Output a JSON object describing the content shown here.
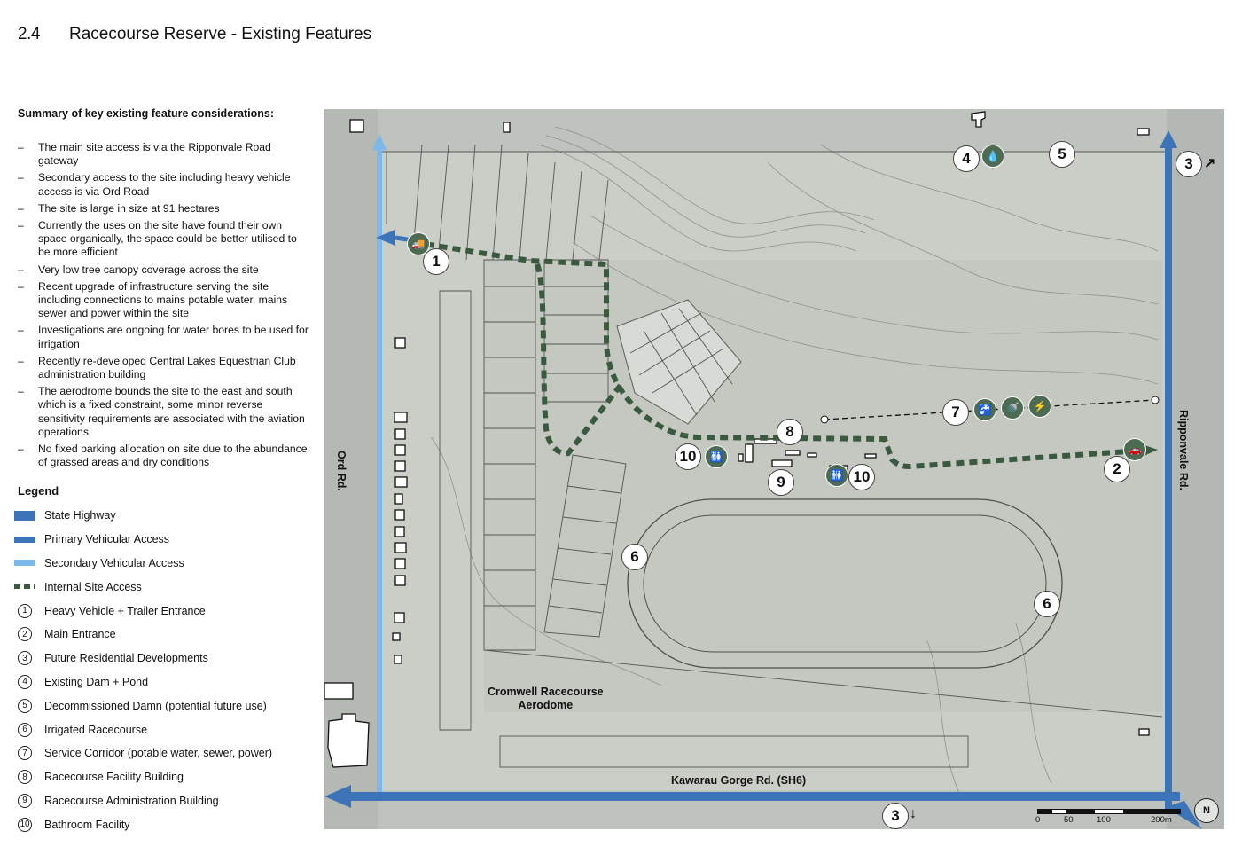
{
  "header": {
    "number": "2.4",
    "title": "Racecourse Reserve - Existing Features"
  },
  "summary": {
    "heading": "Summary of key existing feature considerations:",
    "items": [
      "The main site access is via the Ripponvale Road gateway",
      "Secondary access to the site including heavy vehicle access is via Ord Road",
      "The site is large in size at 91 hectares",
      "Currently the uses on the site have found their own space organically, the space could be better utilised to be more efficient",
      "Very low tree canopy coverage across the site",
      "Recent upgrade of infrastructure serving the site including connections to mains potable water, mains sewer and power within the site",
      "Investigations are ongoing for water bores to be used for irrigation",
      "Recently re-developed Central Lakes Equestrian Club administration building",
      "The aerodrome bounds the site to the east and south which is a fixed constraint, some minor reverse sensitivity requirements are associated with the aviation operations",
      "No fixed parking allocation on site due to the abundance of grassed areas and dry conditions"
    ]
  },
  "legend": {
    "heading": "Legend",
    "items": [
      {
        "symbol": "swatch",
        "color": "#3d74b8",
        "label": "State Highway"
      },
      {
        "symbol": "swatch",
        "color": "#3d74b8",
        "label": "Primary Vehicular Access"
      },
      {
        "symbol": "swatch",
        "color": "#7db8ec",
        "label": "Secondary Vehicular Access"
      },
      {
        "symbol": "dash",
        "color": "#3a5a40",
        "label": "Internal Site Access"
      },
      {
        "symbol": "number",
        "value": "1",
        "label": "Heavy Vehicle + Trailer Entrance"
      },
      {
        "symbol": "number",
        "value": "2",
        "label": "Main Entrance"
      },
      {
        "symbol": "number",
        "value": "3",
        "label": "Future Residential Developments"
      },
      {
        "symbol": "number",
        "value": "4",
        "label": "Existing Dam + Pond"
      },
      {
        "symbol": "number",
        "value": "5",
        "label": "Decommissioned Damn (potential future use)"
      },
      {
        "symbol": "number",
        "value": "6",
        "label": "Irrigated Racecourse"
      },
      {
        "symbol": "number",
        "value": "7",
        "label": "Service Corridor (potable water, sewer, power)"
      },
      {
        "symbol": "number",
        "value": "8",
        "label": "Racecourse Facility Building"
      },
      {
        "symbol": "number",
        "value": "9",
        "label": "Racecourse Administration Building"
      },
      {
        "symbol": "number",
        "value": "10",
        "label": "Bathroom Facility"
      }
    ]
  },
  "map": {
    "road_labels": {
      "ord": "Ord Rd.",
      "ripponvale": "Ripponvale Rd.",
      "sh6": "Kawarau Gorge Rd. (SH6)",
      "aerodrome_line1": "Cromwell Racecourse",
      "aerodrome_line2": "Aerodome"
    },
    "markers": [
      "1",
      "2",
      "3",
      "3",
      "4",
      "5",
      "6",
      "6",
      "7",
      "8",
      "9",
      "10",
      "10"
    ],
    "scale": {
      "t0": "0",
      "t1": "50",
      "t2": "100",
      "t3": "200m"
    },
    "north": "N",
    "colors": {
      "state_highway": "#3d74b8",
      "secondary": "#7db8ec",
      "internal": "#3a5a40",
      "icon_fill": "#4d6a52"
    }
  }
}
